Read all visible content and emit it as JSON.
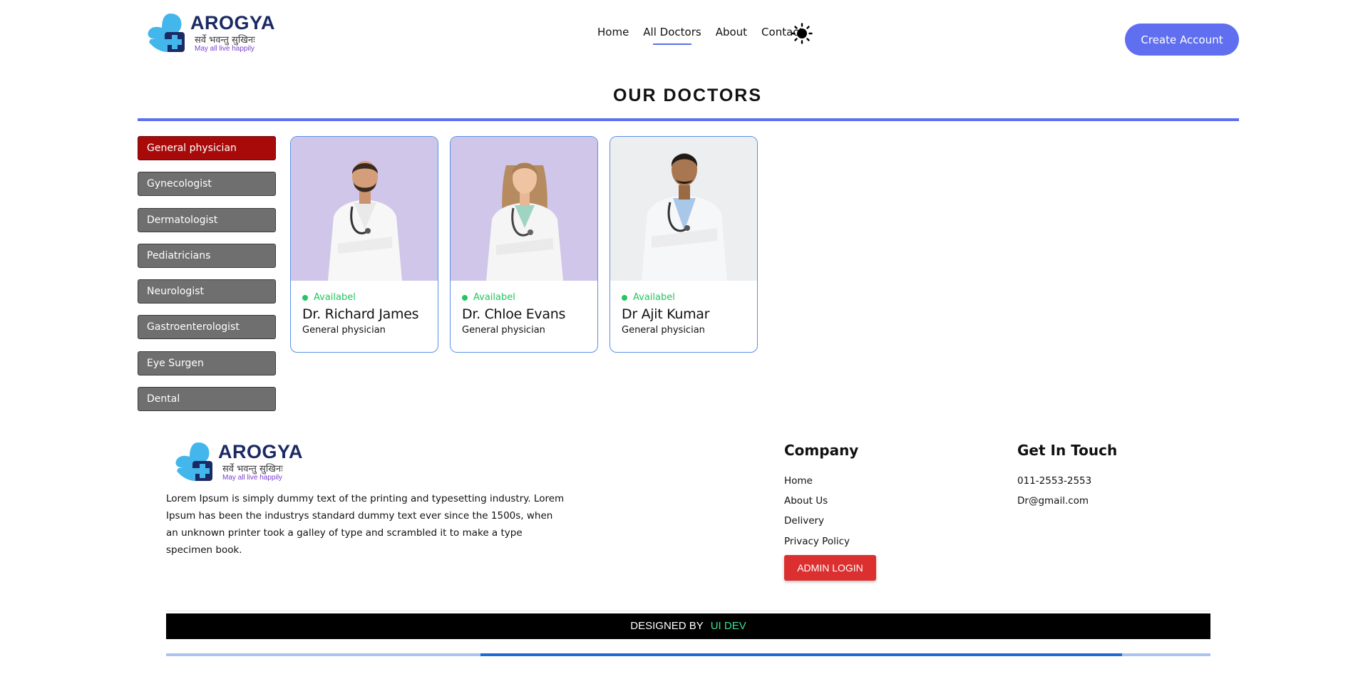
{
  "brand": {
    "name": "AROGYA",
    "tagline": "सर्वे भवन्तु सुखिनः",
    "sub": "May all live happily"
  },
  "nav": {
    "items": [
      {
        "label": "Home"
      },
      {
        "label": "All Doctors"
      },
      {
        "label": "About"
      },
      {
        "label": "Contact"
      }
    ],
    "active": "All Doctors",
    "theme_icon": "sun-icon"
  },
  "header": {
    "cta_label": "Create Account"
  },
  "page": {
    "title": "OUR DOCTORS"
  },
  "specialities": {
    "active": "General physician",
    "items": [
      {
        "label": "General physician"
      },
      {
        "label": "Gynecologist"
      },
      {
        "label": "Dermatologist"
      },
      {
        "label": "Pediatricians"
      },
      {
        "label": "Neurologist"
      },
      {
        "label": "Gastroenterologist"
      },
      {
        "label": "Eye Surgen"
      },
      {
        "label": "Dental"
      }
    ]
  },
  "doctors": [
    {
      "status": "Availabel",
      "name": "Dr. Richard James",
      "speciality": "General physician"
    },
    {
      "status": "Availabel",
      "name": "Dr. Chloe Evans",
      "speciality": "General physician"
    },
    {
      "status": "Availabel",
      "name": "Dr Ajit Kumar",
      "speciality": "General physician"
    }
  ],
  "footer": {
    "description": "Lorem Ipsum is simply dummy text of the printing and typesetting industry. Lorem Ipsum has been the industrys standard dummy text ever since the 1500s, when an unknown printer took a galley of type and scrambled it to make a type specimen book.",
    "company": {
      "title": "Company",
      "links": [
        {
          "label": "Home"
        },
        {
          "label": "About Us"
        },
        {
          "label": "Delivery"
        },
        {
          "label": "Privacy Policy"
        }
      ],
      "admin_label": "ADMIN LOGIN"
    },
    "contact": {
      "title": "Get In Touch",
      "phone": "011-2553-2553",
      "email": "Dr@gmail.com"
    },
    "credit": {
      "prefix": "DESIGNED BY",
      "name": "UI DEV"
    }
  },
  "colors": {
    "accent": "#5f6ff0",
    "active_speciality": "#a80a0a",
    "inactive_speciality": "#6f6f6f",
    "available": "#22c55e",
    "admin_button": "#dc2f2f",
    "credit_highlight": "#38e38f",
    "card_photo_bg": "#d0c6ea"
  }
}
